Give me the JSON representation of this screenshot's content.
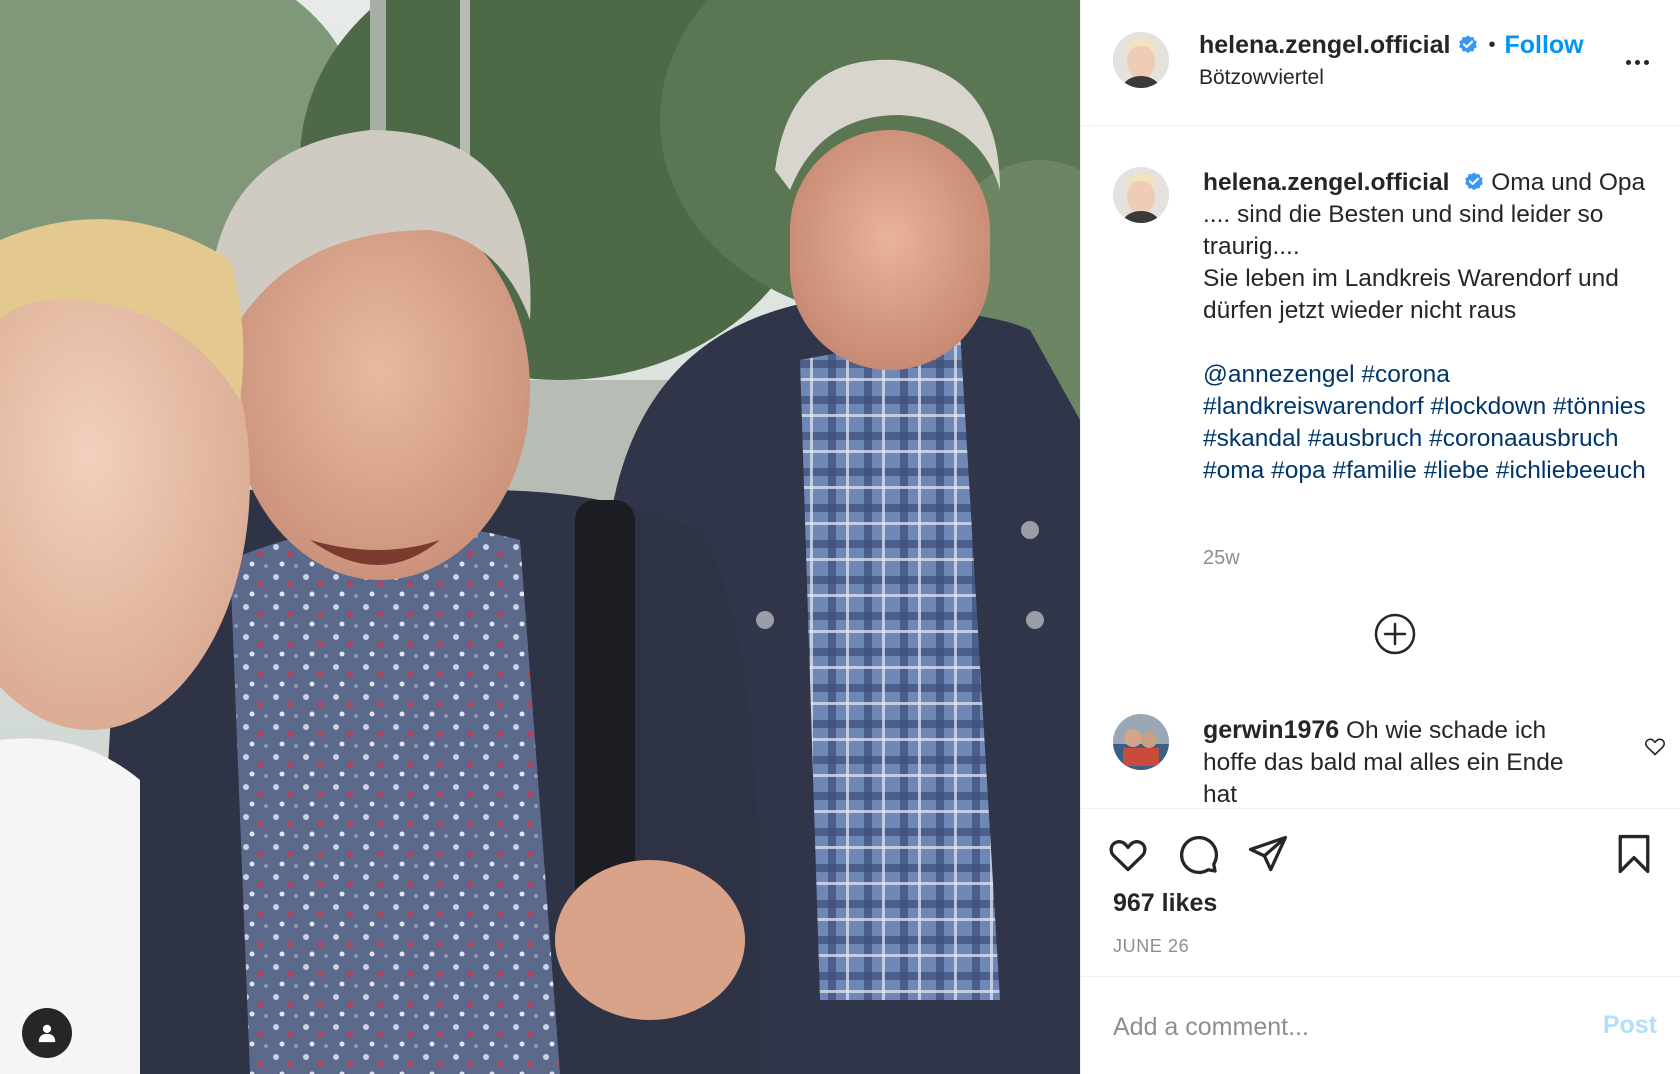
{
  "photo": {
    "icon": "tag-user-icon",
    "description_colors": {
      "sky": "#dfe5e2",
      "foliage": "#4f6b48",
      "jacket": "#2f3446",
      "shirt": "#6c86b8"
    }
  },
  "header": {
    "username": "helena.zengel.official",
    "verified_icon": "verified-badge-icon",
    "separator": "•",
    "follow_label": "Follow",
    "location": "Bötzowviertel",
    "more_icon": "more-options-icon"
  },
  "caption": {
    "username": "helena.zengel.official",
    "text_lines": [
      "Oma und Opa .... sind die Besten und sind leider so traurig....",
      "Sie leben im Landkreis Warendorf und dürfen jetzt wieder nicht raus"
    ],
    "hashtags": [
      "@annezengel",
      "#corona",
      "#landkreiswarendorf",
      "#lockdown",
      "#tönnies",
      "#skandal",
      "#ausbruch",
      "#coronaausbruch",
      "#oma",
      "#opa",
      "#familie",
      "#liebe",
      "#ichliebeeuch"
    ],
    "time_ago": "25w"
  },
  "comments": [
    {
      "username": "gerwin1976",
      "text": "Oh wie schade ich hoffe das bald mal alles ein Ende hat"
    }
  ],
  "actions": {
    "like_icon": "heart-icon",
    "comment_icon": "comment-icon",
    "share_icon": "share-icon",
    "save_icon": "bookmark-icon",
    "likes": "967 likes",
    "date": "JUNE 26"
  },
  "add_comment": {
    "placeholder": "Add a comment...",
    "post_label": "Post"
  },
  "colors": {
    "link_blue": "#0095f6",
    "hashtag_blue": "#00376b",
    "muted_gray": "#8e8e8e",
    "post_disabled": "#b2dffc",
    "verified_blue": "#3897f0"
  }
}
